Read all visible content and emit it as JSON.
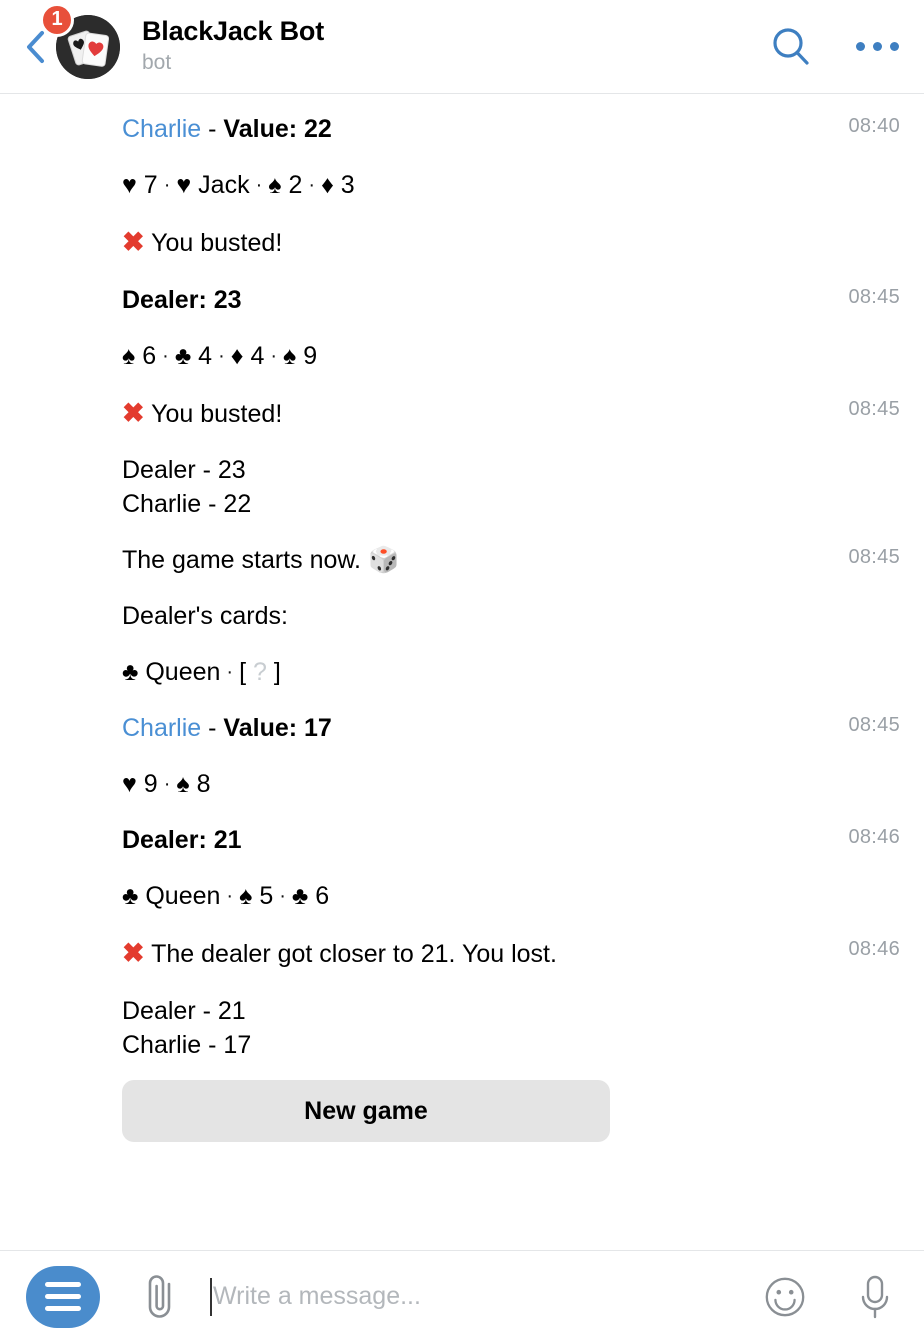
{
  "header": {
    "back_icon": "back-chevron-icon",
    "unread_badge": "1",
    "avatar_icon": "playing-cards-avatar",
    "title": "BlackJack Bot",
    "subtitle": "bot",
    "search_icon": "search-icon",
    "more_icon": "more-options-icon",
    "accent_color": "#3e7fc1",
    "badge_color": "#e8503a"
  },
  "messages": [
    {
      "id": "charlie-value-22",
      "time": "08:40",
      "segments": [
        {
          "kind": "name",
          "text": "Charlie"
        },
        {
          "kind": "plain",
          "text": " - "
        },
        {
          "kind": "bold",
          "text": "Value: 22"
        }
      ]
    },
    {
      "id": "charlie-cards-22",
      "time": "",
      "segments": [
        {
          "kind": "suit",
          "text": "♥"
        },
        {
          "kind": "plain",
          "text": " 7"
        },
        {
          "kind": "sep",
          "text": "·"
        },
        {
          "kind": "suit",
          "text": "♥"
        },
        {
          "kind": "plain",
          "text": " Jack"
        },
        {
          "kind": "sep",
          "text": "·"
        },
        {
          "kind": "suit",
          "text": "♠"
        },
        {
          "kind": "plain",
          "text": " 2"
        },
        {
          "kind": "sep",
          "text": "·"
        },
        {
          "kind": "suit",
          "text": "♦"
        },
        {
          "kind": "plain",
          "text": " 3"
        }
      ]
    },
    {
      "id": "you-busted-1",
      "time": "",
      "segments": [
        {
          "kind": "x",
          "text": "✖"
        },
        {
          "kind": "plain",
          "text": " You busted!"
        }
      ]
    },
    {
      "id": "dealer-23",
      "time": "08:45",
      "segments": [
        {
          "kind": "bold",
          "text": "Dealer: 23"
        }
      ]
    },
    {
      "id": "dealer-cards-23",
      "time": "",
      "segments": [
        {
          "kind": "suit",
          "text": "♠"
        },
        {
          "kind": "plain",
          "text": " 6"
        },
        {
          "kind": "sep",
          "text": "·"
        },
        {
          "kind": "suit",
          "text": "♣"
        },
        {
          "kind": "plain",
          "text": " 4"
        },
        {
          "kind": "sep",
          "text": "·"
        },
        {
          "kind": "suit",
          "text": "♦"
        },
        {
          "kind": "plain",
          "text": " 4"
        },
        {
          "kind": "sep",
          "text": "·"
        },
        {
          "kind": "suit",
          "text": "♠"
        },
        {
          "kind": "plain",
          "text": " 9"
        }
      ]
    },
    {
      "id": "you-busted-2",
      "time": "08:45",
      "segments": [
        {
          "kind": "x",
          "text": "✖"
        },
        {
          "kind": "plain",
          "text": " You busted!"
        }
      ]
    },
    {
      "id": "score-round-1",
      "time": "",
      "segments": [
        {
          "kind": "plain",
          "text": "Dealer - 23\nCharlie - 22"
        }
      ]
    },
    {
      "id": "game-starts",
      "time": "08:45",
      "segments": [
        {
          "kind": "plain",
          "text": "The game starts now. "
        },
        {
          "kind": "dice",
          "text": "🎲"
        }
      ]
    },
    {
      "id": "dealers-cards-label",
      "time": "",
      "segments": [
        {
          "kind": "plain",
          "text": "Dealer's cards:"
        }
      ]
    },
    {
      "id": "dealer-cards-hidden",
      "time": "",
      "segments": [
        {
          "kind": "suit",
          "text": "♣"
        },
        {
          "kind": "plain",
          "text": " Queen"
        },
        {
          "kind": "sep",
          "text": "·"
        },
        {
          "kind": "plain",
          "text": "[ "
        },
        {
          "kind": "hidden",
          "text": "?"
        },
        {
          "kind": "plain",
          "text": " ]"
        }
      ]
    },
    {
      "id": "charlie-value-17",
      "time": "08:45",
      "segments": [
        {
          "kind": "name",
          "text": "Charlie"
        },
        {
          "kind": "plain",
          "text": " - "
        },
        {
          "kind": "bold",
          "text": "Value: 17"
        }
      ]
    },
    {
      "id": "charlie-cards-17",
      "time": "",
      "segments": [
        {
          "kind": "suit",
          "text": "♥"
        },
        {
          "kind": "plain",
          "text": " 9"
        },
        {
          "kind": "sep",
          "text": "·"
        },
        {
          "kind": "suit",
          "text": "♠"
        },
        {
          "kind": "plain",
          "text": " 8"
        }
      ]
    },
    {
      "id": "dealer-21",
      "time": "08:46",
      "segments": [
        {
          "kind": "bold",
          "text": "Dealer: 21"
        }
      ]
    },
    {
      "id": "dealer-cards-21",
      "time": "",
      "segments": [
        {
          "kind": "suit",
          "text": "♣"
        },
        {
          "kind": "plain",
          "text": " Queen"
        },
        {
          "kind": "sep",
          "text": "·"
        },
        {
          "kind": "suit",
          "text": "♠"
        },
        {
          "kind": "plain",
          "text": " 5"
        },
        {
          "kind": "sep",
          "text": "·"
        },
        {
          "kind": "suit",
          "text": "♣"
        },
        {
          "kind": "plain",
          "text": " 6"
        }
      ]
    },
    {
      "id": "you-lost",
      "time": "08:46",
      "segments": [
        {
          "kind": "x",
          "text": "✖"
        },
        {
          "kind": "plain",
          "text": " The dealer got closer to 21. You lost."
        }
      ]
    },
    {
      "id": "score-round-2",
      "time": "",
      "segments": [
        {
          "kind": "plain",
          "text": "Dealer - 21\nCharlie - 17"
        }
      ]
    }
  ],
  "inline_keyboard": {
    "new_game_label": "New game"
  },
  "composer": {
    "menu_icon": "bot-menu-icon",
    "attach_icon": "paperclip-icon",
    "placeholder": "Write a message...",
    "value": "",
    "emoji_icon": "smiley-icon",
    "mic_icon": "microphone-icon"
  }
}
